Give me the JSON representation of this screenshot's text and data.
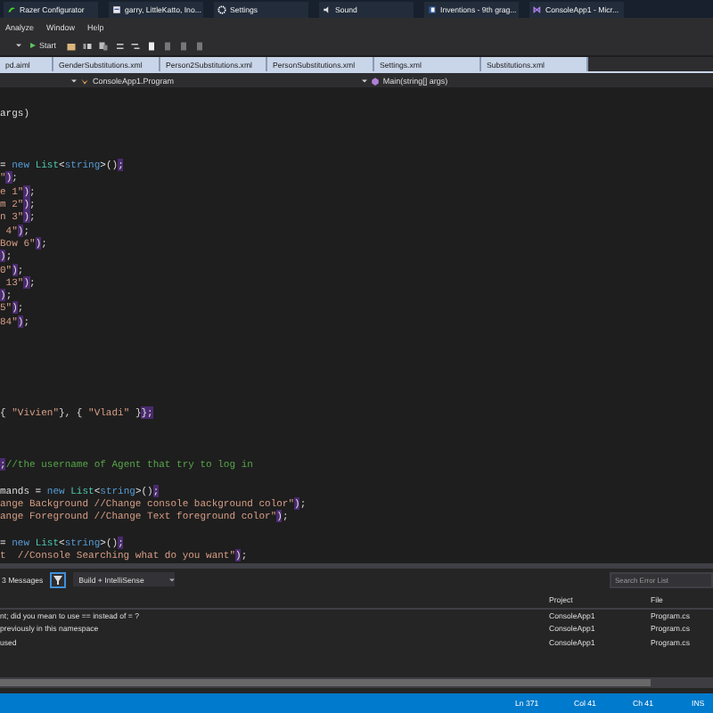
{
  "taskbar": [
    {
      "label": "Razer Configurator"
    },
    {
      "label": "garry, LittleKatto, Ino..."
    },
    {
      "label": "Settings"
    },
    {
      "label": "Sound"
    },
    {
      "label": "Inventions - 9th grag..."
    },
    {
      "label": "ConsoleApp1 - Micr..."
    }
  ],
  "menu": [
    "Analyze",
    "Window",
    "Help"
  ],
  "toolbar": {
    "start": "Start"
  },
  "doc_tabs": [
    {
      "label": "pd.aiml",
      "selected": false
    },
    {
      "label": "GenderSubstitutions.xml",
      "selected": false
    },
    {
      "label": "Person2Substitutions.xml",
      "selected": false
    },
    {
      "label": "PersonSubstitutions.xml",
      "selected": false
    },
    {
      "label": "Settings.xml",
      "selected": false
    },
    {
      "label": "Substitutions.xml",
      "selected": false
    }
  ],
  "nav_bar": {
    "class": "ConsoleApp1.Program",
    "member": "Main(string[] args)"
  },
  "code_lines": [
    {
      "kind": "code",
      "segments": [
        {
          "kind": "plain",
          "text": "args)"
        }
      ]
    },
    {
      "kind": "blank"
    },
    {
      "kind": "blank"
    },
    {
      "kind": "blank"
    },
    {
      "kind": "code",
      "segments": [
        {
          "kind": "plain",
          "text": "= "
        },
        {
          "kind": "keyword",
          "text": "new"
        },
        {
          "kind": "type",
          "text": " List"
        },
        {
          "kind": "plain",
          "text": "<"
        },
        {
          "kind": "keyword",
          "text": "string"
        },
        {
          "kind": "plain",
          "text": ">()"
        },
        {
          "kind": "match",
          "text": ";"
        }
      ]
    },
    {
      "kind": "code",
      "segments": [
        {
          "kind": "string",
          "text": "\""
        },
        {
          "kind": "match",
          "text": ")"
        },
        {
          "kind": "plain",
          "text": ";"
        }
      ]
    },
    {
      "kind": "code",
      "segments": [
        {
          "kind": "string",
          "text": "e 1\""
        },
        {
          "kind": "match",
          "text": ")"
        },
        {
          "kind": "plain",
          "text": ";"
        }
      ]
    },
    {
      "kind": "code",
      "segments": [
        {
          "kind": "string",
          "text": "m 2\""
        },
        {
          "kind": "match",
          "text": ")"
        },
        {
          "kind": "plain",
          "text": ";"
        }
      ]
    },
    {
      "kind": "code",
      "segments": [
        {
          "kind": "string",
          "text": "n 3\""
        },
        {
          "kind": "match",
          "text": ")"
        },
        {
          "kind": "plain",
          "text": ";"
        }
      ]
    },
    {
      "kind": "code",
      "segments": [
        {
          "kind": "string",
          "text": " 4\""
        },
        {
          "kind": "match",
          "text": ")"
        },
        {
          "kind": "plain",
          "text": ";"
        }
      ]
    },
    {
      "kind": "code",
      "segments": [
        {
          "kind": "string",
          "text": "Bow 6\""
        },
        {
          "kind": "match",
          "text": ")"
        },
        {
          "kind": "plain",
          "text": ";"
        }
      ]
    },
    {
      "kind": "code",
      "segments": [
        {
          "kind": "match",
          "text": ")"
        },
        {
          "kind": "plain",
          "text": ";"
        }
      ]
    },
    {
      "kind": "code",
      "segments": [
        {
          "kind": "string",
          "text": "0\""
        },
        {
          "kind": "match",
          "text": ")"
        },
        {
          "kind": "plain",
          "text": ";"
        }
      ]
    },
    {
      "kind": "code",
      "segments": [
        {
          "kind": "string",
          "text": " 13\""
        },
        {
          "kind": "match",
          "text": ")"
        },
        {
          "kind": "plain",
          "text": ";"
        }
      ]
    },
    {
      "kind": "code",
      "segments": [
        {
          "kind": "match",
          "text": ")"
        },
        {
          "kind": "plain",
          "text": ";"
        }
      ]
    },
    {
      "kind": "code",
      "segments": [
        {
          "kind": "string",
          "text": "5\""
        },
        {
          "kind": "match",
          "text": ")"
        },
        {
          "kind": "plain",
          "text": ";"
        }
      ]
    },
    {
      "kind": "code",
      "segments": [
        {
          "kind": "string",
          "text": "84\""
        },
        {
          "kind": "match",
          "text": ")"
        },
        {
          "kind": "plain",
          "text": ";"
        }
      ]
    },
    {
      "kind": "blank"
    },
    {
      "kind": "blank"
    },
    {
      "kind": "blank"
    },
    {
      "kind": "blank"
    },
    {
      "kind": "blank"
    },
    {
      "kind": "blank"
    },
    {
      "kind": "code",
      "segments": [
        {
          "kind": "plain",
          "text": "{ "
        },
        {
          "kind": "string",
          "text": "\"Vivien\""
        },
        {
          "kind": "plain",
          "text": "}, { "
        },
        {
          "kind": "string",
          "text": "\"Vladi\""
        },
        {
          "kind": "plain",
          "text": " }"
        },
        {
          "kind": "match",
          "text": "};"
        }
      ]
    },
    {
      "kind": "blank"
    },
    {
      "kind": "blank"
    },
    {
      "kind": "blank"
    },
    {
      "kind": "code",
      "segments": [
        {
          "kind": "match",
          "text": ";"
        },
        {
          "kind": "comment",
          "text": "//the username of Agent that try to log in"
        }
      ]
    },
    {
      "kind": "blank"
    },
    {
      "kind": "code",
      "segments": [
        {
          "kind": "plain",
          "text": "mands = "
        },
        {
          "kind": "keyword",
          "text": "new"
        },
        {
          "kind": "type",
          "text": " List"
        },
        {
          "kind": "plain",
          "text": "<"
        },
        {
          "kind": "keyword",
          "text": "string"
        },
        {
          "kind": "plain",
          "text": ">()"
        },
        {
          "kind": "match",
          "text": ";"
        }
      ]
    },
    {
      "kind": "code",
      "segments": [
        {
          "kind": "string",
          "text": "ange Background //Change console background color\""
        },
        {
          "kind": "match",
          "text": ")"
        },
        {
          "kind": "plain",
          "text": ";"
        }
      ]
    },
    {
      "kind": "code",
      "segments": [
        {
          "kind": "string",
          "text": "ange Foreground //Change Text foreground color\""
        },
        {
          "kind": "match",
          "text": ")"
        },
        {
          "kind": "plain",
          "text": ";"
        }
      ]
    },
    {
      "kind": "blank"
    },
    {
      "kind": "code",
      "segments": [
        {
          "kind": "plain",
          "text": "= "
        },
        {
          "kind": "keyword",
          "text": "new"
        },
        {
          "kind": "type",
          "text": " List"
        },
        {
          "kind": "plain",
          "text": "<"
        },
        {
          "kind": "keyword",
          "text": "string"
        },
        {
          "kind": "plain",
          "text": ">()"
        },
        {
          "kind": "match",
          "text": ";"
        }
      ]
    },
    {
      "kind": "code",
      "segments": [
        {
          "kind": "string",
          "text": "t  //Console Searching what do you want\""
        },
        {
          "kind": "match",
          "text": ")"
        },
        {
          "kind": "plain",
          "text": ";"
        }
      ]
    }
  ],
  "error_list": {
    "messages": "3 Messages",
    "scope": "Build + IntelliSense",
    "search": {
      "placeholder": "Search Error List"
    },
    "columns": [
      "Project",
      "File"
    ],
    "rows": [
      {
        "description": "nt; did you mean to use == instead of = ?",
        "project": "ConsoleApp1",
        "file": "Program.cs"
      },
      {
        "description": "previously in this namespace",
        "project": "ConsoleApp1",
        "file": "Program.cs"
      },
      {
        "description": "used",
        "project": "ConsoleApp1",
        "file": "Program.cs"
      }
    ]
  },
  "status_bar": {
    "line": "Ln 371",
    "col": "Col 41",
    "ch": "Ch 41",
    "mode": "INS"
  }
}
